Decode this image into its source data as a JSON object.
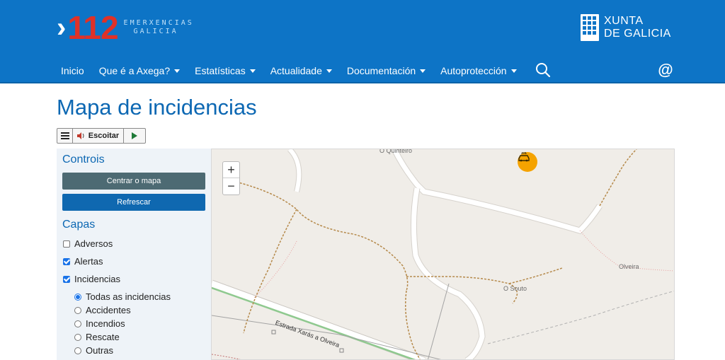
{
  "header": {
    "logo_number": "112",
    "logo_line1": "EMERXENCIAS",
    "logo_line2": "GALICIA",
    "xunta_line1": "XUNTA",
    "xunta_line2": "DE GALICIA"
  },
  "nav": {
    "items": [
      {
        "label": "Inicio",
        "dropdown": false
      },
      {
        "label": "Que é a Axega?",
        "dropdown": true
      },
      {
        "label": "Estatísticas",
        "dropdown": true
      },
      {
        "label": "Actualidade",
        "dropdown": true
      },
      {
        "label": "Documentación",
        "dropdown": true
      },
      {
        "label": "Autoprotección",
        "dropdown": true
      }
    ],
    "search_icon": "search-icon",
    "contact_icon": "at-icon",
    "contact_glyph": "@"
  },
  "page": {
    "title": "Mapa de incidencias"
  },
  "readspeaker": {
    "listen_label": "Escoitar"
  },
  "sidebar": {
    "controls_title": "Controis",
    "center_button": "Centrar o mapa",
    "refresh_button": "Refrescar",
    "layers_title": "Capas",
    "layers": [
      {
        "label": "Adversos",
        "checked": false
      },
      {
        "label": "Alertas",
        "checked": true
      },
      {
        "label": "Incidencias",
        "checked": true
      }
    ],
    "incident_types": [
      {
        "label": "Todas as incidencias",
        "selected": true
      },
      {
        "label": "Accidentes",
        "selected": false
      },
      {
        "label": "Incendios",
        "selected": false
      },
      {
        "label": "Rescate",
        "selected": false
      },
      {
        "label": "Outras",
        "selected": false
      }
    ]
  },
  "map": {
    "zoom_in": "+",
    "zoom_out": "−",
    "places": [
      "O Quinteiro",
      "Olveira",
      "O Souto"
    ],
    "road_label": "Estrada Xarás a Olveira",
    "incident_color": "#f5a300"
  },
  "colors": {
    "header_bg": "#0d74c6",
    "title": "#0d68b3",
    "button_grey": "#4d6a73",
    "button_blue": "#0f68b0",
    "logo_red": "#e03127"
  }
}
